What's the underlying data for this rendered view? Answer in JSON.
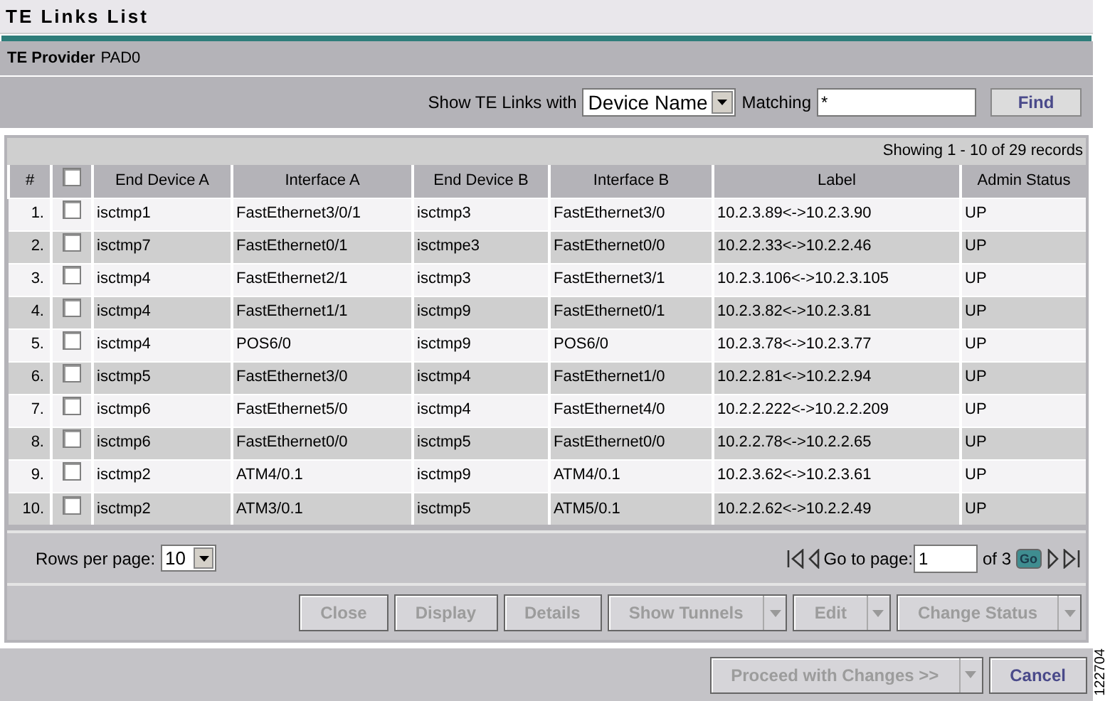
{
  "window": {
    "title": "TE Links List"
  },
  "provider": {
    "label": "TE Provider",
    "value": "PAD0"
  },
  "filter": {
    "label": "Show TE Links with",
    "field": "Device Name",
    "matching_label": "Matching",
    "matching_value": "*",
    "find_button": {
      "label": "Find",
      "disabled": false
    }
  },
  "table": {
    "summary": "Showing 1 - 10 of 29 records",
    "select_all_checked": false,
    "columns": [
      "#",
      "",
      "End Device A",
      "Interface A",
      "End Device B",
      "Interface B",
      "Label",
      "Admin Status"
    ],
    "rows": [
      {
        "checked": false,
        "cells": [
          "1.",
          "",
          "isctmp1",
          "FastEthernet3/0/1",
          "isctmp3",
          "FastEthernet3/0",
          "10.2.3.89<->10.2.3.90",
          "UP"
        ]
      },
      {
        "checked": false,
        "cells": [
          "2.",
          "",
          "isctmp7",
          "FastEthernet0/1",
          "isctmpe3",
          "FastEthernet0/0",
          "10.2.2.33<->10.2.2.46",
          "UP"
        ]
      },
      {
        "checked": false,
        "cells": [
          "3.",
          "",
          "isctmp4",
          "FastEthernet2/1",
          "isctmp3",
          "FastEthernet3/1",
          "10.2.3.106<->10.2.3.105",
          "UP"
        ]
      },
      {
        "checked": false,
        "cells": [
          "4.",
          "",
          "isctmp4",
          "FastEthernet1/1",
          "isctmp9",
          "FastEthernet0/1",
          "10.2.3.82<->10.2.3.81",
          "UP"
        ]
      },
      {
        "checked": false,
        "cells": [
          "5.",
          "",
          "isctmp4",
          "POS6/0",
          "isctmp9",
          "POS6/0",
          "10.2.3.78<->10.2.3.77",
          "UP"
        ]
      },
      {
        "checked": false,
        "cells": [
          "6.",
          "",
          "isctmp5",
          "FastEthernet3/0",
          "isctmp4",
          "FastEthernet1/0",
          "10.2.2.81<->10.2.2.94",
          "UP"
        ]
      },
      {
        "checked": false,
        "cells": [
          "7.",
          "",
          "isctmp6",
          "FastEthernet5/0",
          "isctmp4",
          "FastEthernet4/0",
          "10.2.2.222<->10.2.2.209",
          "UP"
        ]
      },
      {
        "checked": false,
        "cells": [
          "8.",
          "",
          "isctmp6",
          "FastEthernet0/0",
          "isctmp5",
          "FastEthernet0/0",
          "10.2.2.78<->10.2.2.65",
          "UP"
        ]
      },
      {
        "checked": false,
        "cells": [
          "9.",
          "",
          "isctmp2",
          "ATM4/0.1",
          "isctmp9",
          "ATM4/0.1",
          "10.2.3.62<->10.2.3.61",
          "UP"
        ]
      },
      {
        "checked": false,
        "cells": [
          "10.",
          "",
          "isctmp2",
          "ATM3/0.1",
          "isctmp5",
          "ATM5/0.1",
          "10.2.2.62<->10.2.2.49",
          "UP"
        ]
      }
    ]
  },
  "pagination": {
    "rows_label": "Rows per page:",
    "rows_value": "10",
    "goto_label": "Go to page:",
    "page_value": "1",
    "of_label": "of 3",
    "go_button": "Go"
  },
  "actions": [
    {
      "label": "Close",
      "disabled": true,
      "dropdown": false
    },
    {
      "label": "Display",
      "disabled": true,
      "dropdown": false
    },
    {
      "label": "Details",
      "disabled": true,
      "dropdown": false
    },
    {
      "label": "Show Tunnels",
      "disabled": true,
      "dropdown": true
    },
    {
      "label": "Edit",
      "disabled": true,
      "dropdown": true
    },
    {
      "label": "Change Status",
      "disabled": true,
      "dropdown": true
    }
  ],
  "footer_buttons": [
    {
      "label": "Proceed with Changes >>",
      "disabled": true,
      "dropdown": true
    },
    {
      "label": "Cancel",
      "disabled": false,
      "dropdown": false
    }
  ],
  "figure_number": "122704"
}
